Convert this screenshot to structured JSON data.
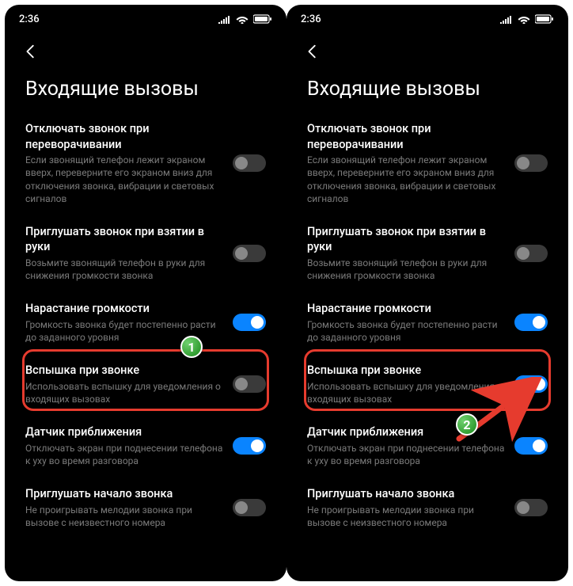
{
  "status": {
    "time": "2:36"
  },
  "back_label": "Назад",
  "page_title": "Входящие вызовы",
  "items": [
    {
      "title": "Отключать звонок при переворачивании",
      "desc": "Если звонящий телефон лежит экраном вверх, переверните его экраном вниз для отключения звонка, вибрации и световых сигналов"
    },
    {
      "title": "Приглушать звонок при взятии в руки",
      "desc": "Возьмите звонящий телефон в руки для снижения громкости звонка"
    },
    {
      "title": "Нарастание громкости",
      "desc": "Громкость звонка будет постепенно расти до заданного уровня"
    },
    {
      "title": "Вспышка при звонке",
      "desc": "Использовать вспышку для уведомления о входящих вызовах"
    },
    {
      "title": "Датчик приближения",
      "desc": "Отключать экран при поднесении телефона к уху во время разговора"
    },
    {
      "title": "Приглушать начало звонка",
      "desc": "Не проигрывать мелодии звонка при вызове с неизвестного номера"
    }
  ],
  "toggles_left": [
    false,
    false,
    true,
    false,
    true,
    false
  ],
  "toggles_right": [
    false,
    false,
    true,
    true,
    true,
    false
  ],
  "badges": [
    "1",
    "2"
  ]
}
